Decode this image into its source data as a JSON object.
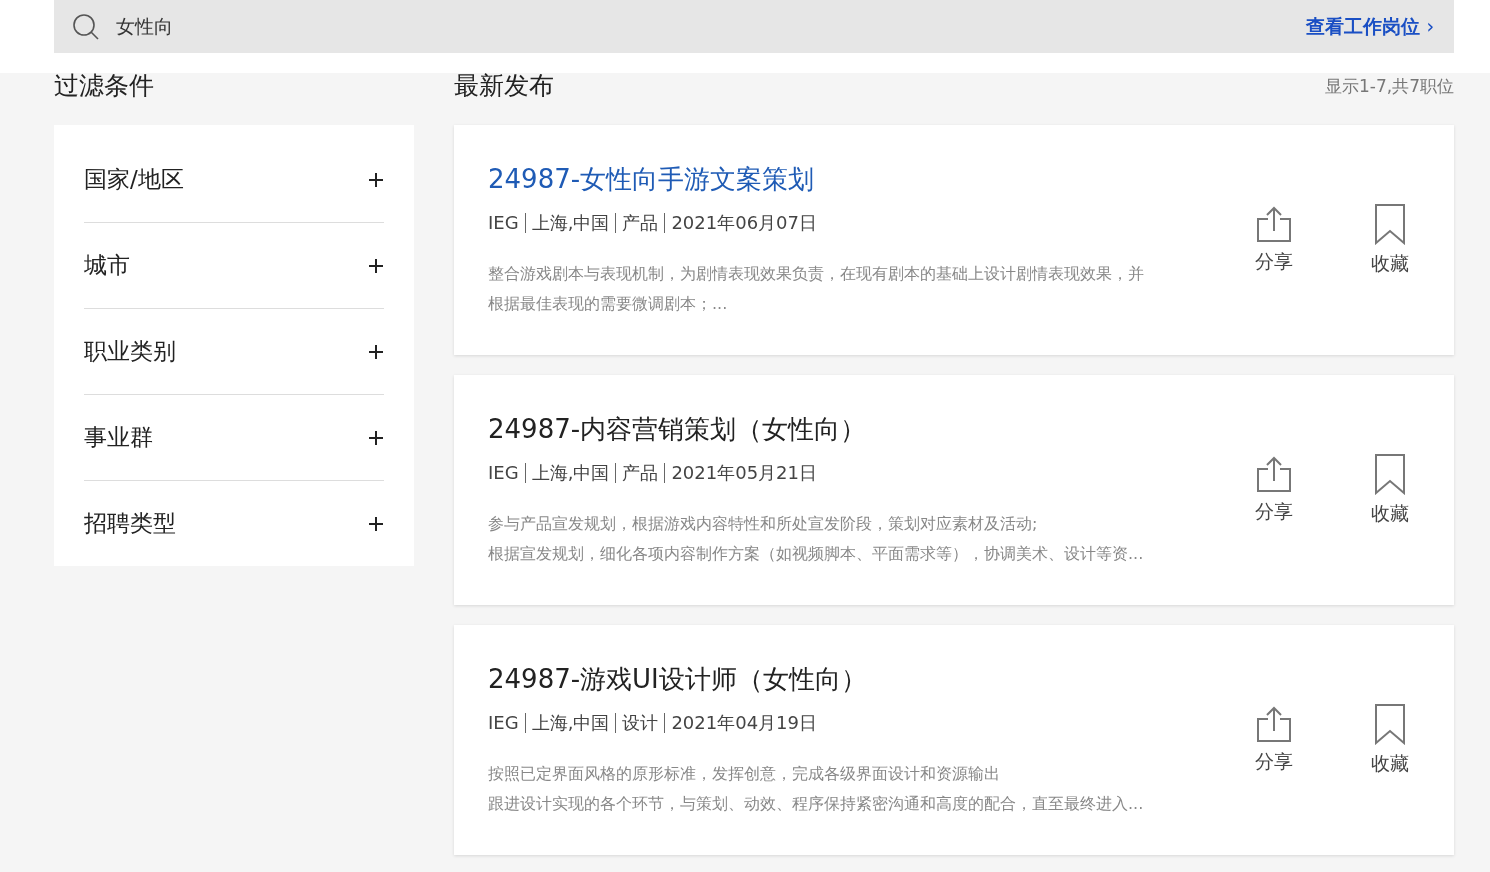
{
  "search": {
    "value": "女性向",
    "link": "查看工作岗位",
    "link_icon": "›"
  },
  "filters": {
    "title": "过滤条件",
    "items": [
      {
        "label": "国家/地区",
        "expanded": false
      },
      {
        "label": "城市",
        "expanded": false
      },
      {
        "label": "职业类别",
        "expanded": false
      },
      {
        "label": "事业群",
        "expanded": false
      },
      {
        "label": "招聘类型",
        "expanded": false
      }
    ]
  },
  "results": {
    "title": "最新发布",
    "count": "显示1-7,共7职位",
    "jobs": [
      {
        "title": "24987-女性向手游文案策划",
        "highlighted": true,
        "meta": [
          "IEG",
          "上海,中国",
          "产品",
          "2021年06月07日"
        ],
        "description": [
          "整合游戏剧本与表现机制，为剧情表现效果负责，在现有剧本的基础上设计剧情表现效果，并",
          "根据最佳表现的需要微调剧本；..."
        ],
        "share": "分享",
        "save": "收藏",
        "saved": false
      },
      {
        "title": "24987-内容营销策划（女性向）",
        "highlighted": false,
        "meta": [
          "IEG",
          "上海,中国",
          "产品",
          "2021年05月21日"
        ],
        "description": [
          "参与产品宣发规划，根据游戏内容特性和所处宣发阶段，策划对应素材及活动;",
          "根据宣发规划，细化各项内容制作方案（如视频脚本、平面需求等），协调美术、设计等资..."
        ],
        "share": "分享",
        "save": "收藏",
        "saved": false
      },
      {
        "title": "24987-游戏UI设计师（女性向）",
        "highlighted": false,
        "meta": [
          "IEG",
          "上海,中国",
          "设计",
          "2021年04月19日"
        ],
        "description": [
          "按照已定界面风格的原形标准，发挥创意，完成各级界面设计和资源输出",
          "跟进设计实现的各个环节，与策划、动效、程序保持紧密沟通和高度的配合，直至最终进入..."
        ],
        "share": "分享",
        "save": "收藏",
        "saved": false
      }
    ]
  }
}
